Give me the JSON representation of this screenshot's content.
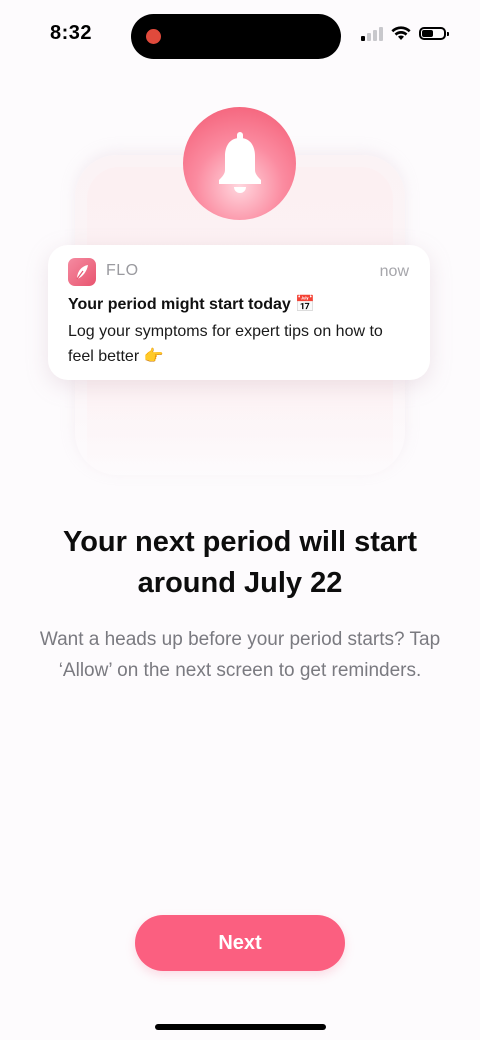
{
  "status_bar": {
    "time": "8:32"
  },
  "notification": {
    "app_name": "FLO",
    "time": "now",
    "title": "Your period might start today 📅",
    "body": "Log your symptoms for expert tips on how to feel better 👉"
  },
  "main": {
    "headline": "Your next period will start around July 22",
    "subtext": "Want a heads up before your period starts? Tap ‘Allow’ on the next screen to get reminders."
  },
  "actions": {
    "next_label": "Next"
  },
  "colors": {
    "accent": "#fb5f80",
    "bell_gradient_start": "#f2566f",
    "bell_gradient_end": "#ffd6de",
    "app_icon": "#e8546f",
    "recording_dot": "#e04a3c"
  },
  "icons": {
    "bell": "bell-icon",
    "app": "flo-feather-icon",
    "wifi": "wifi-icon",
    "signal": "cellular-signal-icon",
    "battery": "battery-icon"
  }
}
